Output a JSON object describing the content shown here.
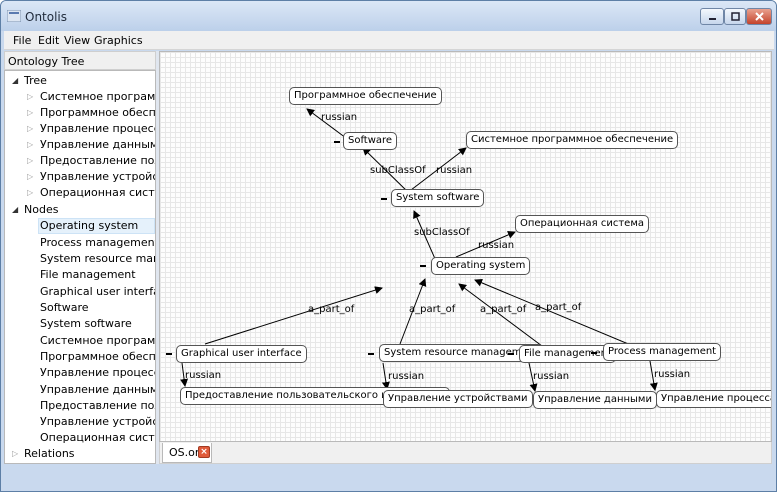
{
  "window": {
    "title": "Ontolis"
  },
  "menu": {
    "items": [
      "File",
      "Edit",
      "View",
      "Graphics"
    ]
  },
  "tree": {
    "header": "Ontology Tree",
    "groups": [
      {
        "label": "Tree",
        "expanded": true,
        "children": [
          "Системное программное...",
          "Программное обеспечен...",
          "Управление процессами",
          "Управление данными",
          "Предоставление пользов...",
          "Управление устройствами",
          "Операционная система"
        ]
      },
      {
        "label": "Nodes",
        "expanded": true,
        "selected": "Operating system",
        "children": [
          "Operating system",
          "Process management",
          "System resource manage...",
          "File management",
          "Graphical user interface",
          "Software",
          "System software",
          "Системное программное...",
          "Программное обеспечен...",
          "Управление процессами",
          "Управление данными",
          "Предоставление пользов...",
          "Управление устройствами",
          "Операционная система"
        ]
      },
      {
        "label": "Relations",
        "expanded": false,
        "children": []
      }
    ]
  },
  "graph": {
    "nodes": {
      "prog_obesp": "Программное обеспечение",
      "software": "Software",
      "sys_prog_obesp": "Системное программное обеспечение",
      "system_software": "System software",
      "op_sys_ru": "Операционная система",
      "operating_system": "Operating system",
      "gui": "Graphical user interface",
      "srm": "System resource management",
      "file_mgmt": "File management",
      "proc_mgmt": "Process management",
      "gui_ru": "Предоставление пользовательского интерфейса",
      "srm_ru": "Управление устройствами",
      "file_ru": "Управление данными",
      "proc_ru": "Управление процессами"
    },
    "edge_labels": {
      "russian": "russian",
      "subclass": "subClassOf",
      "part_of": "a_part_of"
    }
  },
  "tabs": [
    {
      "label": "OS.ont",
      "close_icon": "close-icon"
    }
  ],
  "colors": {
    "tab_close": "#e05a3a",
    "selection": "#e5f1fb"
  }
}
